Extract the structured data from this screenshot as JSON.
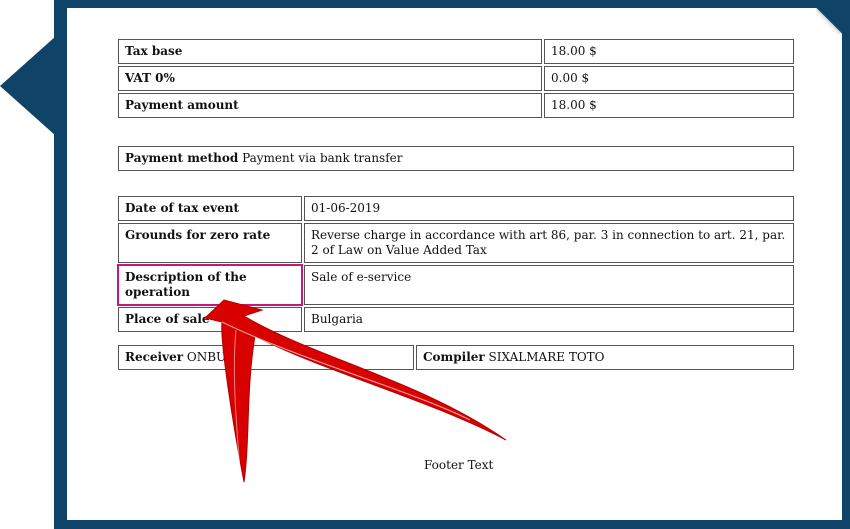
{
  "totals": [
    {
      "label": "Tax base",
      "value": "18.00 $"
    },
    {
      "label": "VAT 0%",
      "value": "0.00 $"
    },
    {
      "label": "Payment amount",
      "value": "18.00 $"
    }
  ],
  "payment": {
    "label": "Payment method",
    "value": "Payment via bank transfer"
  },
  "details": [
    {
      "label": "Date of tax event",
      "value": "01-06-2019"
    },
    {
      "label": "Grounds for zero rate",
      "value": "Reverse charge in accordance with art 86, par. 3 in connection to art. 21, par. 2 of Law on Value Added Tax"
    },
    {
      "label": "Description of the operation",
      "value": "Sale of e-service"
    },
    {
      "label": "Place of sale",
      "value": "Bulgaria"
    }
  ],
  "parties": {
    "receiver_label": "Receiver",
    "receiver_value": "ONBUS",
    "compiler_label": "Compiler",
    "compiler_value": "SIXALMARE TOTO"
  },
  "footer": "Footer Text",
  "colors": {
    "frame": "#0f4468",
    "highlight": "#c8177a",
    "arrow": "#d90000"
  }
}
